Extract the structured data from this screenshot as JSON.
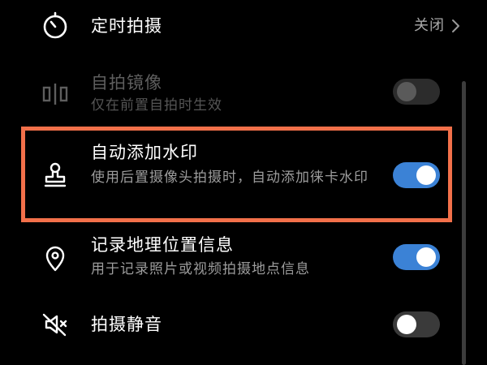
{
  "settings": {
    "timer": {
      "title": "定时拍摄",
      "value": "关闭",
      "icon": "timer-icon"
    },
    "selfie_mirror": {
      "title": "自拍镜像",
      "subtitle": "仅在前置自拍时生效",
      "enabled": false,
      "disabled": true,
      "icon": "mirror-icon"
    },
    "watermark": {
      "title": "自动添加水印",
      "subtitle": "使用后置摄像头拍摄时，自动添加徕卡水印",
      "enabled": true,
      "icon": "stamp-icon"
    },
    "location": {
      "title": "记录地理位置信息",
      "subtitle": "用于记录照片或视频拍摄地点信息",
      "enabled": true,
      "icon": "location-pin-icon"
    },
    "mute": {
      "title": "拍摄静音",
      "enabled": false,
      "icon": "mute-icon"
    }
  },
  "colors": {
    "background": "#000000",
    "toggle_on": "#3b82d6",
    "highlight": "#f2704a"
  }
}
